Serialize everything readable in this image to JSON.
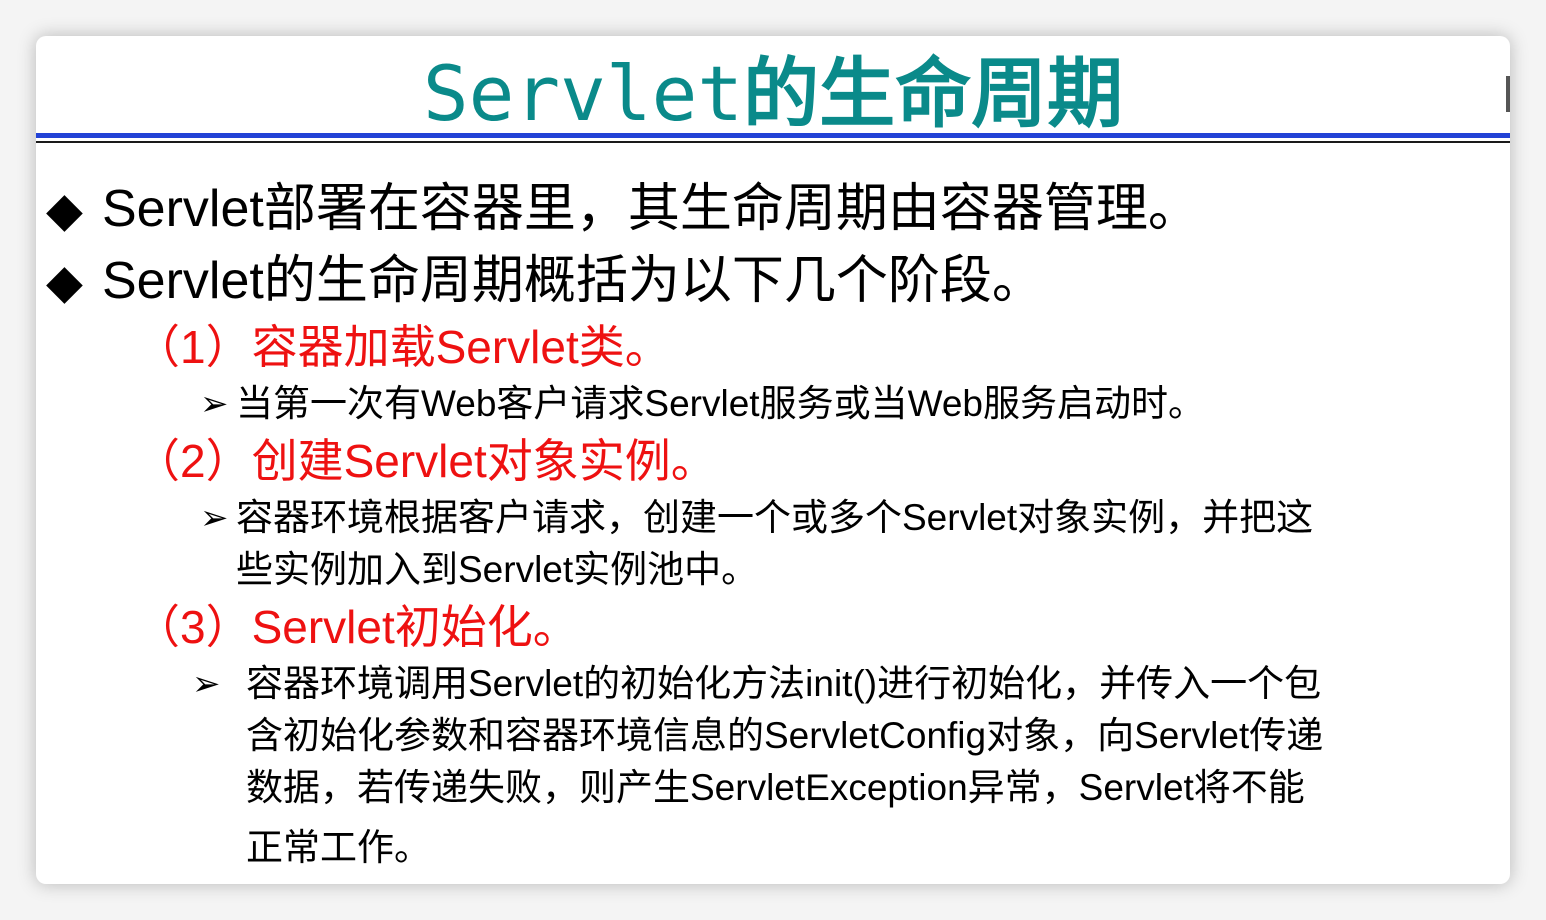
{
  "slide": {
    "title_latin": "Servlet",
    "title_cjk": "的生命周期",
    "bullets": [
      {
        "marker": "◆",
        "text": "Servlet部署在容器里，其生命周期由容器管理。"
      },
      {
        "marker": "◆",
        "text": "Servlet的生命周期概括为以下几个阶段。"
      }
    ],
    "steps": [
      {
        "label": "（1）容器加载Servlet类。",
        "detail_marker": "➢",
        "detail": "当第一次有Web客户请求Servlet服务或当Web服务启动时。"
      },
      {
        "label": "（2）创建Servlet对象实例。",
        "detail_marker": "➢",
        "detail_lines": [
          "容器环境根据客户请求，创建一个或多个Servlet对象实例，并把这",
          "些实例加入到Servlet实例池中。"
        ]
      },
      {
        "label": "（3）Servlet初始化。",
        "detail_marker": "➢",
        "detail_lines": [
          "容器环境调用Servlet的初始化方法init()进行初始化，并传入一个包",
          "含初始化参数和容器环境信息的ServletConfig对象，向Servlet传递",
          "数据，若传递失败，则产生ServletException异常，Servlet将不能",
          "正常工作。"
        ]
      }
    ]
  },
  "colors": {
    "title": "#0a8a8a",
    "step": "#ee1111",
    "rule": "#2242d6",
    "text": "#000000"
  }
}
